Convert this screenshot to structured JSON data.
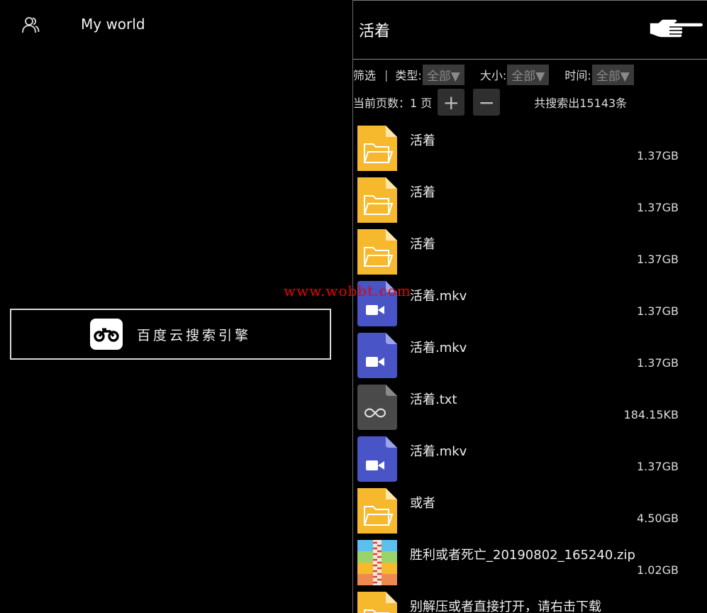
{
  "left_panel": {
    "title": "My world",
    "engine_label": "百度云搜索引擎"
  },
  "right_panel": {
    "query": "活着",
    "filters": {
      "label": "筛选",
      "type_label": "类型:",
      "type_value": "全部▼",
      "size_label": "大小:",
      "size_value": "全部▼",
      "time_label": "时间:",
      "time_value": "全部▼"
    },
    "pagination": {
      "current_label": "当前页数：1 页",
      "plus": "+",
      "minus": "−",
      "result_count": "共搜索出15143条"
    },
    "files": [
      {
        "icon": "folder-icon",
        "name": "活着",
        "size": "1.37GB"
      },
      {
        "icon": "folder-icon",
        "name": "活着",
        "size": "1.37GB"
      },
      {
        "icon": "folder-icon",
        "name": "活着",
        "size": "1.37GB"
      },
      {
        "icon": "video-file-icon",
        "name": "活着.mkv",
        "size": "1.37GB"
      },
      {
        "icon": "video-file-icon",
        "name": "活着.mkv",
        "size": "1.37GB"
      },
      {
        "icon": "text-file-icon",
        "name": "活着.txt",
        "size": "184.15KB"
      },
      {
        "icon": "video-file-icon",
        "name": "活着.mkv",
        "size": "1.37GB"
      },
      {
        "icon": "folder-icon",
        "name": "或者",
        "size": "4.50GB"
      },
      {
        "icon": "zip-file-icon",
        "name": "胜利或者死亡_20190802_165240.zip",
        "size": "1.02GB"
      },
      {
        "icon": "folder-icon",
        "name": "别解压或者直接打开，请右击下载",
        "size": ""
      }
    ]
  },
  "watermark": "www.wobbt.com",
  "colors": {
    "folder": "#F6B92E",
    "folder_fold": "#FCE6A8",
    "video": "#4954C6",
    "text_file": "#4A4A4A",
    "watermark": "#EE0000"
  }
}
